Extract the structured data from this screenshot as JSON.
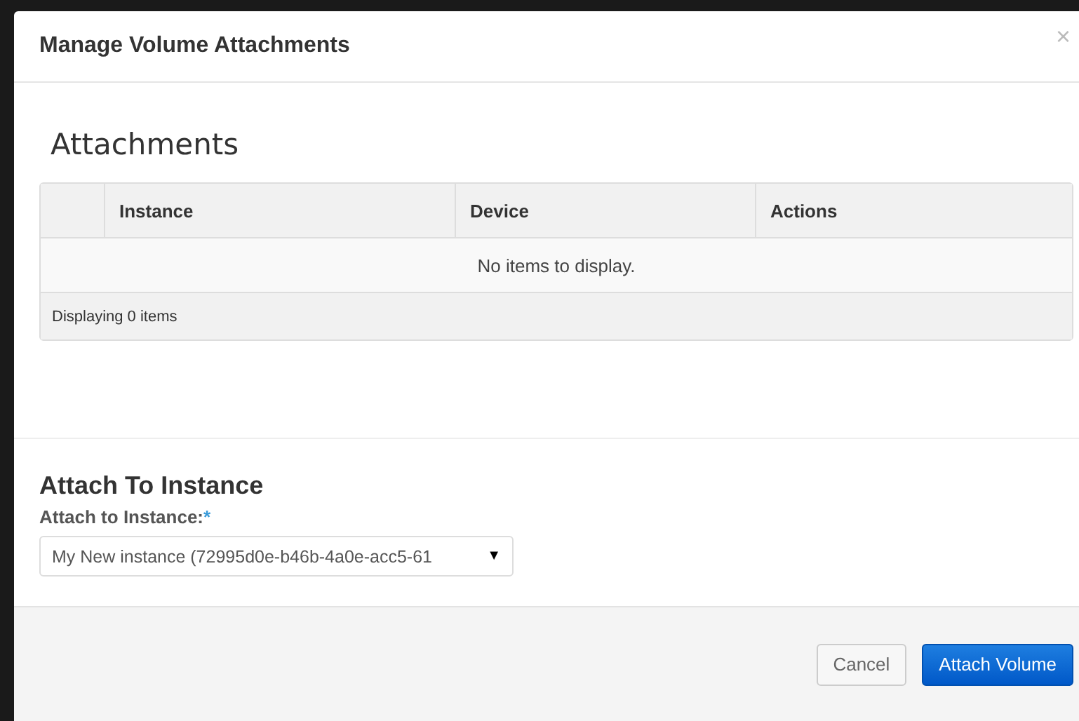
{
  "modal": {
    "title": "Manage Volume Attachments",
    "close": "×"
  },
  "attachments": {
    "heading": "Attachments",
    "table": {
      "columns": [
        "",
        "Instance",
        "Device",
        "Actions"
      ],
      "empty_message": "No items to display.",
      "footer": "Displaying 0 items"
    }
  },
  "attach_section": {
    "heading": "Attach To Instance",
    "label": "Attach to Instance:",
    "required_mark": "*",
    "select_value": "My New instance (72995d0e-b46b-4a0e-acc5-61",
    "caret": "▼"
  },
  "buttons": [
    {
      "label": "Cancel",
      "kind": "secondary"
    },
    {
      "label": "Attach Volume",
      "kind": "primary"
    }
  ]
}
